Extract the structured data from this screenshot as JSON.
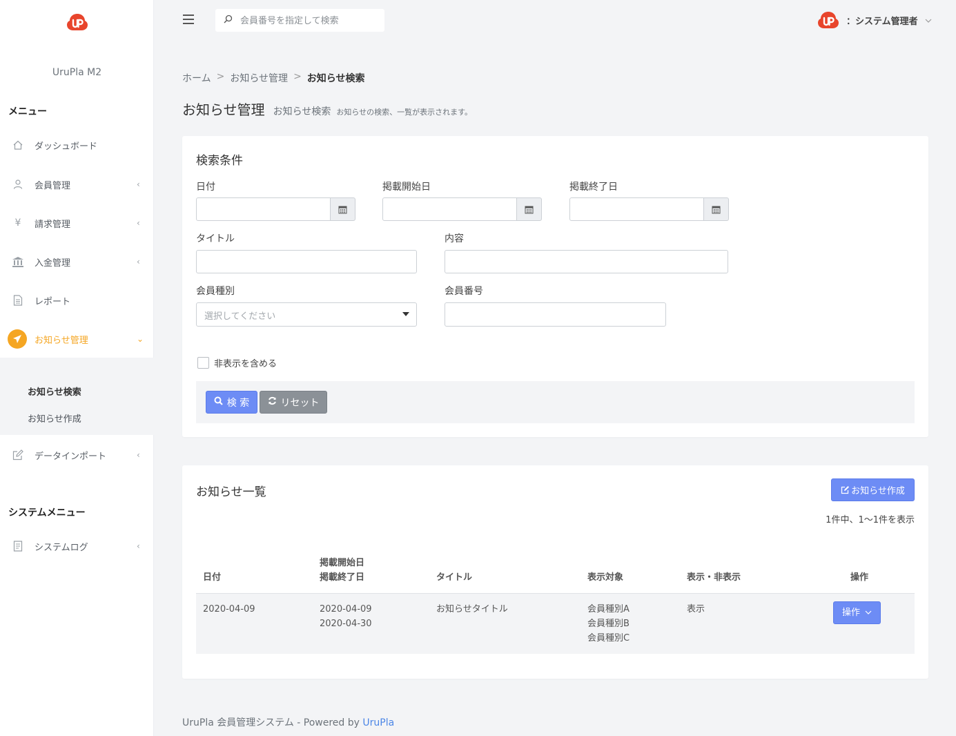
{
  "sidebar": {
    "brand": "UruPla M2",
    "menu_heading": "メニュー",
    "items": [
      {
        "label": "ダッシュボード",
        "icon": "home-icon",
        "has_children": false
      },
      {
        "label": "会員管理",
        "icon": "user-icon",
        "has_children": true
      },
      {
        "label": "請求管理",
        "icon": "yen-icon",
        "has_children": true
      },
      {
        "label": "入金管理",
        "icon": "bank-icon",
        "has_children": true
      },
      {
        "label": "レポート",
        "icon": "document-icon",
        "has_children": false
      },
      {
        "label": "お知らせ管理",
        "icon": "paper-plane-icon",
        "has_children": true,
        "active": true
      },
      {
        "label": "データインポート",
        "icon": "edit-icon",
        "has_children": true
      }
    ],
    "submenu": [
      "お知らせ検索",
      "お知らせ作成"
    ],
    "system_heading": "システムメニュー",
    "system_items": [
      {
        "label": "システムログ",
        "icon": "log-icon",
        "has_children": true
      }
    ]
  },
  "topbar": {
    "search_placeholder": "会員番号を指定して検索",
    "user_name": "：システム管理者"
  },
  "breadcrumb": [
    "ホーム",
    "お知らせ管理",
    "お知らせ検索"
  ],
  "page": {
    "title": "お知らせ管理",
    "subtitle": "お知らせ検索",
    "description": "お知らせの検索、一覧が表示されます。"
  },
  "search_form": {
    "title": "検索条件",
    "date_label": "日付",
    "start_label": "掲載開始日",
    "end_label": "掲載終了日",
    "title_label": "タイトル",
    "content_label": "内容",
    "member_type_label": "会員種別",
    "member_type_placeholder": "選択してください",
    "member_no_label": "会員番号",
    "hidden_checkbox_label": "非表示を含める",
    "search_button": "検 索",
    "reset_button": "リセット"
  },
  "list": {
    "title": "お知らせ一覧",
    "create_button": "お知らせ作成",
    "count_text": "1件中、1〜1件を表示",
    "headers": {
      "date": "日付",
      "start": "掲載開始日",
      "end": "掲載終了日",
      "title": "タイトル",
      "target": "表示対象",
      "visibility": "表示・非表示",
      "action": "操作"
    },
    "rows": [
      {
        "date": "2020-04-09",
        "start": "2020-04-09",
        "end": "2020-04-30",
        "title": "お知らせタイトル",
        "targets": [
          "会員種別A",
          "会員種別B",
          "会員種別C"
        ],
        "visibility": "表示",
        "action_label": "操作"
      }
    ]
  },
  "footer": {
    "text": "UruPla 会員管理システム - Powered by ",
    "link": "UruPla"
  },
  "colors": {
    "accent": "#f5a623",
    "primary_button": "#6d8cf5",
    "secondary_button": "#8b9197",
    "logo": "#e8452c",
    "link": "#4c86e6"
  }
}
